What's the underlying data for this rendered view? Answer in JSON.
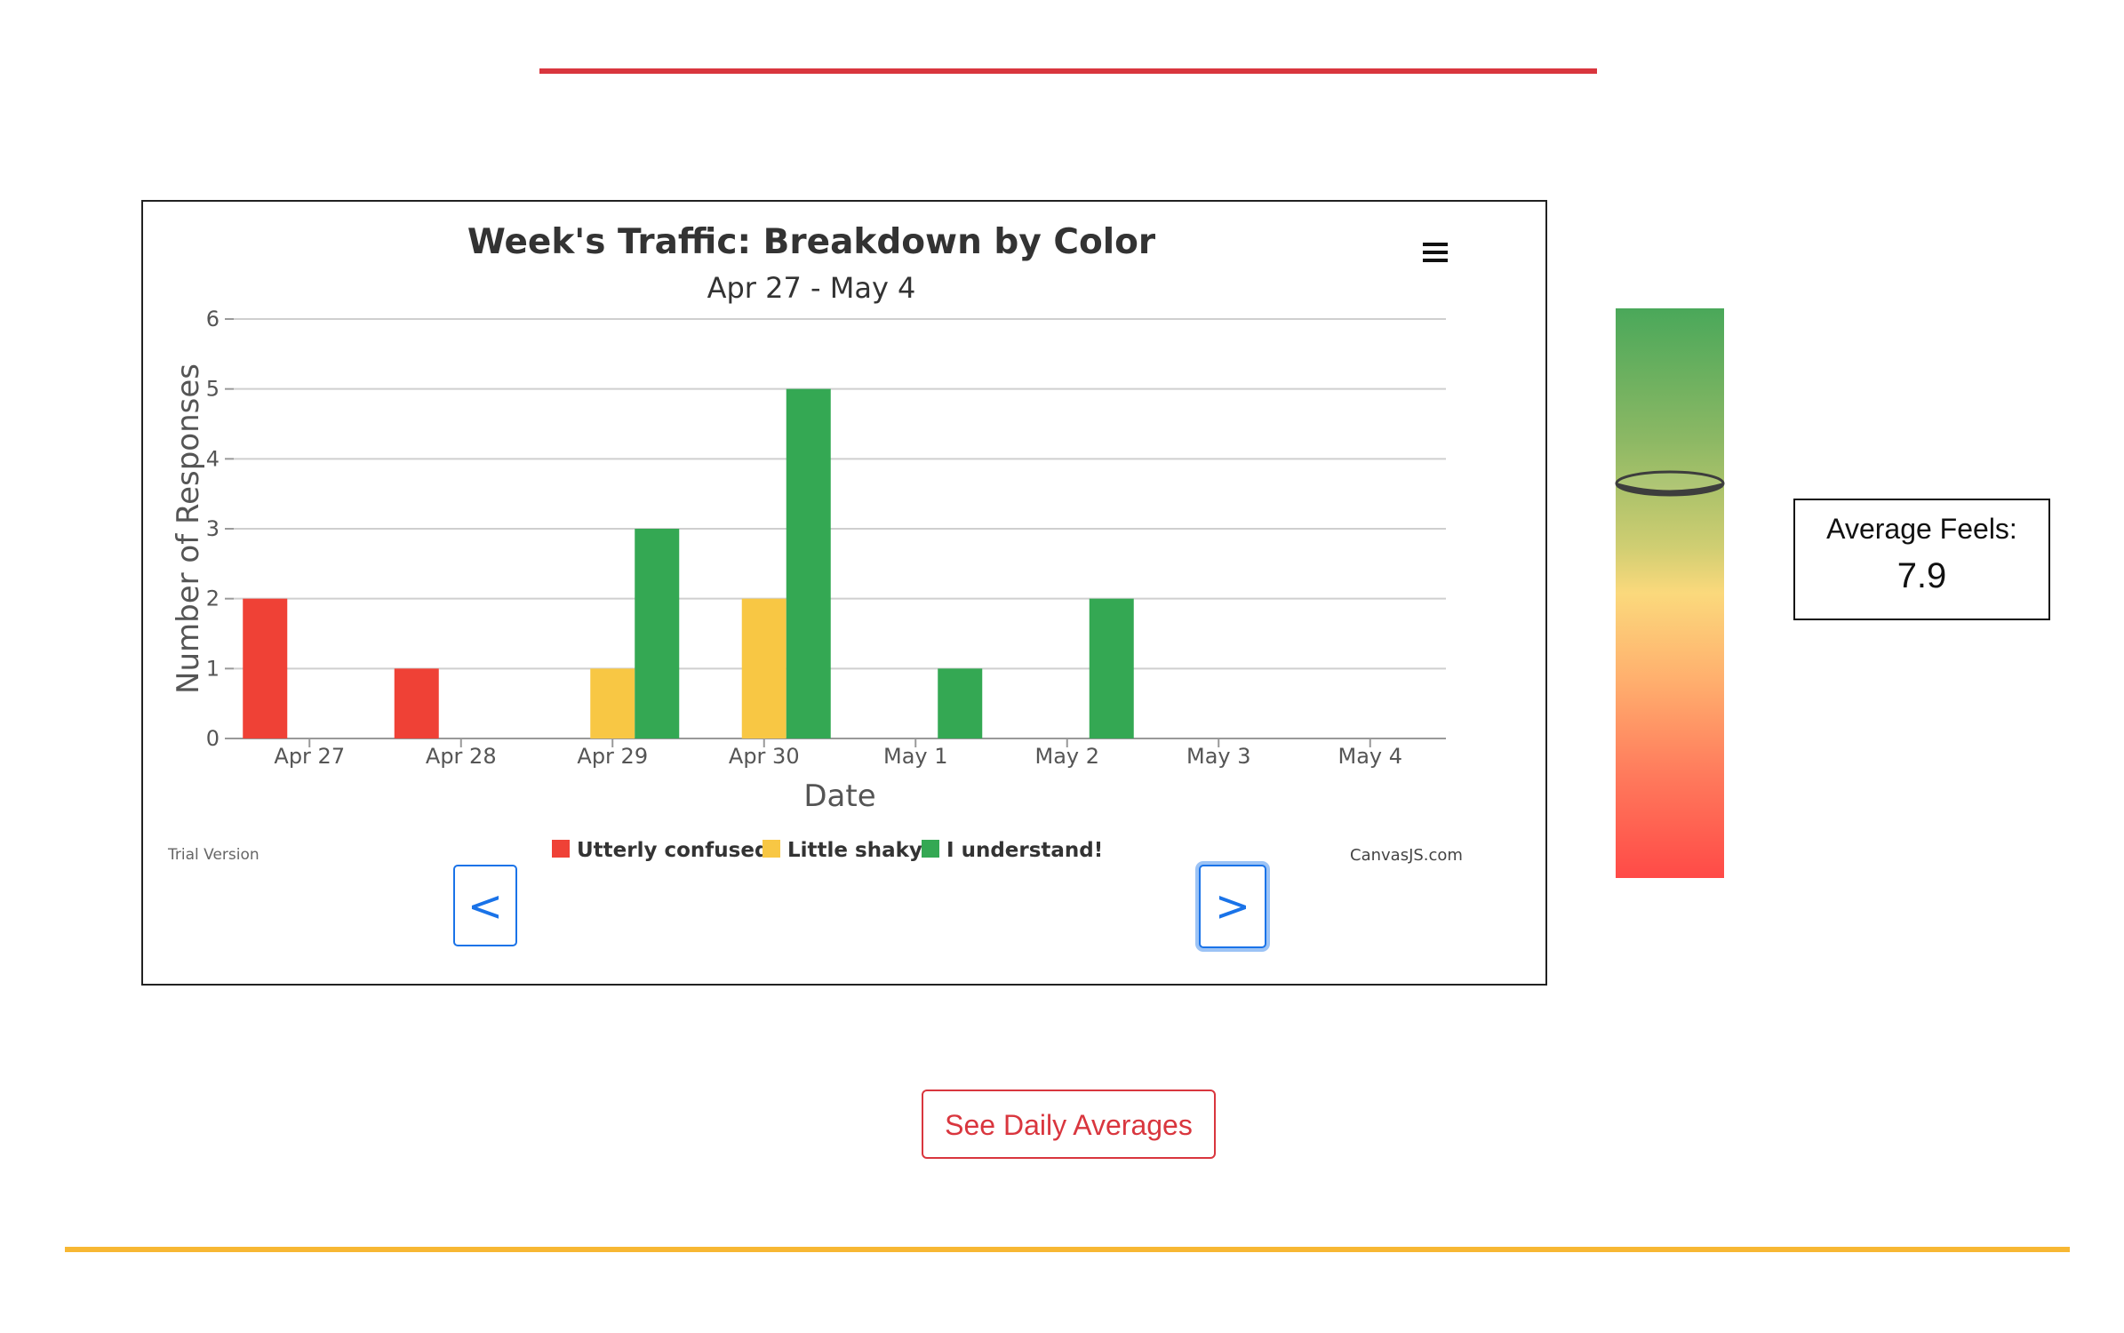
{
  "chart_data": {
    "type": "bar",
    "title": "Week's Traffic: Breakdown by Color",
    "subtitle": "Apr 27 - May 4",
    "xlabel": "Date",
    "ylabel": "Number of Responses",
    "categories": [
      "Apr 27",
      "Apr 28",
      "Apr 29",
      "Apr 30",
      "May 1",
      "May 2",
      "May 3",
      "May 4"
    ],
    "ylim": [
      0,
      6
    ],
    "yticks": [
      "0",
      "1",
      "2",
      "3",
      "4",
      "5",
      "6"
    ],
    "grid": true,
    "legend_position": "bottom",
    "series": [
      {
        "name": "Utterly confused",
        "color": "#ef4136",
        "values": [
          2,
          1,
          0,
          0,
          0,
          0,
          0,
          0
        ]
      },
      {
        "name": "Little shaky",
        "color": "#f8c744",
        "values": [
          0,
          0,
          1,
          2,
          0,
          0,
          0,
          0
        ]
      },
      {
        "name": "I understand!",
        "color": "#34a853",
        "values": [
          0,
          0,
          3,
          5,
          1,
          2,
          0,
          0
        ]
      }
    ],
    "trial_text": "Trial Version",
    "credit_text": "CanvasJS.com"
  },
  "nav": {
    "prev_label": "<",
    "next_label": ">"
  },
  "gauge": {
    "level": 0.69
  },
  "average": {
    "label": "Average Feels:",
    "value": "7.9"
  },
  "daily_button": {
    "label": "See Daily Averages"
  },
  "colors": {
    "accent_red": "#d9363e",
    "accent_yellow": "#f7b733",
    "nav_blue": "#1a73e8"
  }
}
